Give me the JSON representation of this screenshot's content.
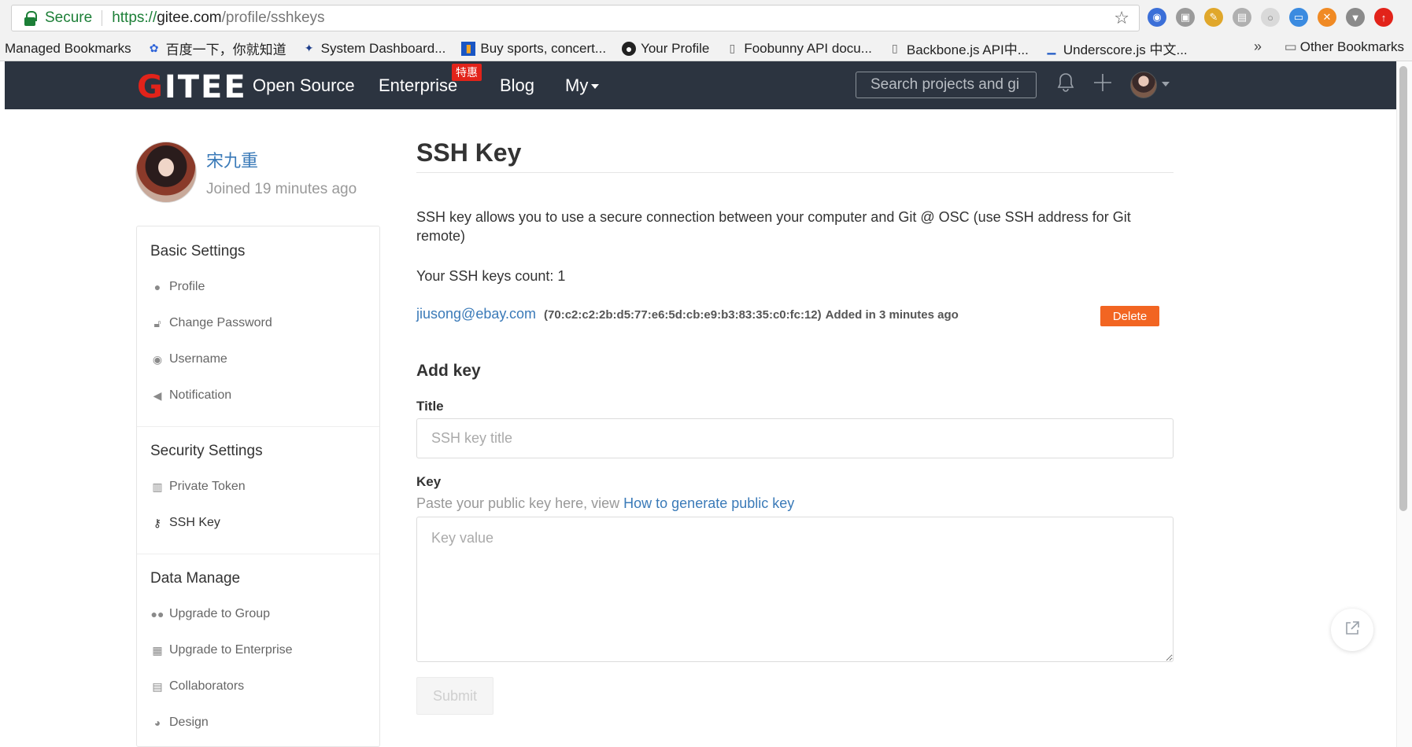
{
  "browser": {
    "secure_label": "Secure",
    "url_scheme": "https://",
    "url_host": "gitee.com",
    "url_path": "/profile/sshkeys",
    "bookmarks": [
      {
        "label": "Managed Bookmarks",
        "icon": "folder-icon"
      },
      {
        "label": "百度一下，你就知道",
        "icon": "baidu-icon"
      },
      {
        "label": "System Dashboard...",
        "icon": "dashboard-icon"
      },
      {
        "label": "Buy sports, concert...",
        "icon": "ticket-icon"
      },
      {
        "label": "Your Profile",
        "icon": "github-icon"
      },
      {
        "label": "Foobunny API docu...",
        "icon": "page-icon"
      },
      {
        "label": "Backbone.js API中...",
        "icon": "page-icon"
      },
      {
        "label": "Underscore.js 中文...",
        "icon": "underscore-icon"
      }
    ],
    "overflow_label": "»",
    "other_bookmarks": "Other Bookmarks"
  },
  "header": {
    "logo_first": "G",
    "logo_rest": "ITEE",
    "nav": {
      "open_source": "Open Source",
      "enterprise": "Enterprise",
      "enterprise_badge": "特惠",
      "blog": "Blog",
      "my": "My"
    },
    "search_placeholder": "Search projects and gi"
  },
  "profile": {
    "name": "宋九重",
    "joined": "Joined 19 minutes ago"
  },
  "sidebar": {
    "basic_title": "Basic Settings",
    "basic_items": [
      "Profile",
      "Change Password",
      "Username",
      "Notification"
    ],
    "security_title": "Security Settings",
    "security_items": [
      "Private Token",
      "SSH Key"
    ],
    "data_title": "Data Manage",
    "data_items": [
      "Upgrade to Group",
      "Upgrade to Enterprise",
      "Collaborators",
      "Design"
    ]
  },
  "main": {
    "title": "SSH Key",
    "description": "SSH key allows you to use a secure connection between your computer and Git @ OSC (use SSH address for Git remote)",
    "keys_count": "Your SSH keys count: 1",
    "key": {
      "email": "jiusong@ebay.com",
      "fingerprint": "(70:c2:c2:2b:d5:77:e6:5d:cb:e9:b3:83:35:c0:fc:12)",
      "added": "Added in 3 minutes ago",
      "delete_label": "Delete"
    },
    "add_key_title": "Add key",
    "title_label": "Title",
    "title_placeholder": "SSH key title",
    "key_label": "Key",
    "hint_text": "Paste your public key here, view ",
    "hint_link": "How to generate public key",
    "key_placeholder": "Key value",
    "submit_label": "Submit"
  },
  "colors": {
    "header_bg": "#2c3440",
    "brand_red": "#e2231a",
    "link_blue": "#3a7ab8",
    "delete_orange": "#f26522"
  }
}
